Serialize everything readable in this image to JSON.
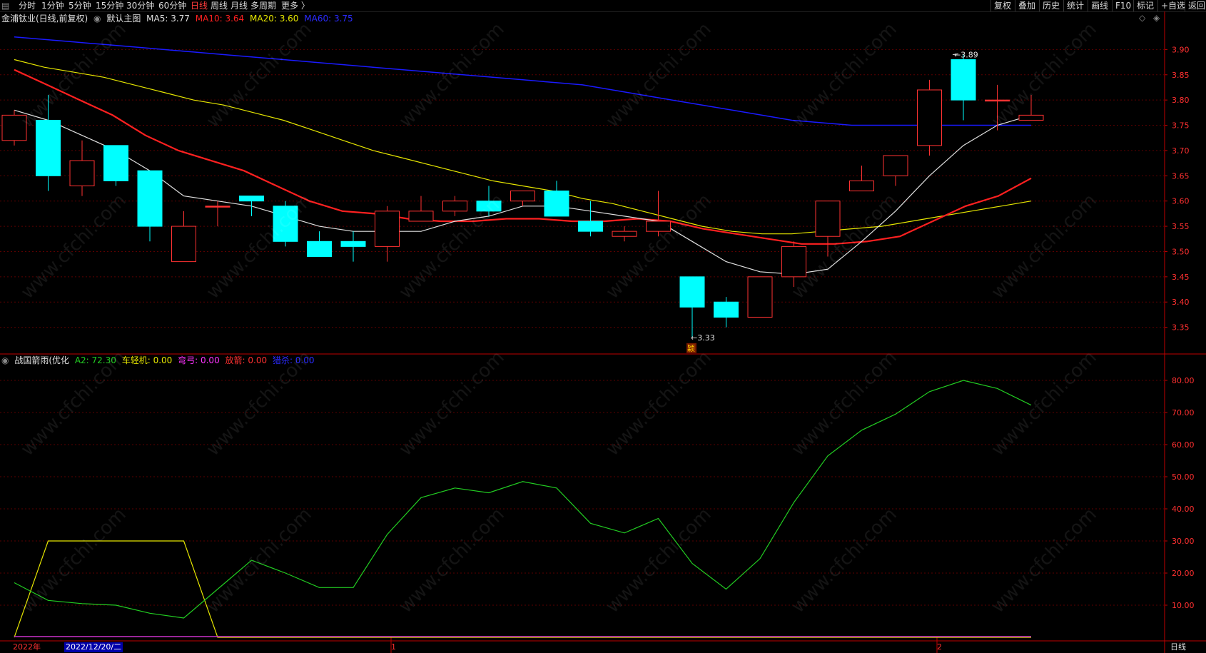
{
  "toolbar": {
    "periods": [
      "分时",
      "1分钟",
      "5分钟",
      "15分钟",
      "30分钟",
      "60分钟",
      "日线",
      "周线",
      "月线",
      "多周期",
      "更多 〉"
    ],
    "active_period": "日线",
    "right_buttons": [
      "复权",
      "叠加",
      "历史",
      "统计",
      "画线",
      "F10",
      "标记",
      "+自选",
      "返回"
    ]
  },
  "main_legend": {
    "stock": "金浦钛业(日线,前复权)",
    "indicator": "默认主图",
    "ma5": "MA5: 3.77",
    "ma10": "MA10: 3.64",
    "ma20": "MA20: 3.60",
    "ma60": "MA60: 3.75"
  },
  "sub_legend": {
    "name": "战国箭雨(优化",
    "a2": "A2: 72.30",
    "chelunji": "车轻机: 0.00",
    "wanggong": "弯弓: 0.00",
    "fangjian": "放箭: 0.00",
    "jiansha": "猎杀: 0.00"
  },
  "bottom": {
    "year": "2022年",
    "date": "2022/12/20/二",
    "m1": "1",
    "m2": "2",
    "period": "日线"
  },
  "annotations": {
    "high": "3.89",
    "low": "3.33",
    "marker": "颖"
  },
  "colors": {
    "up": "#ff3232",
    "down": "#00ffff",
    "ma5": "#e0e0e0",
    "ma10": "#ff2020",
    "ma20": "#e6e600",
    "ma60": "#1a1aff",
    "a2": "#22cc22",
    "yellow_line": "#e6e600",
    "grid": "#5a0000",
    "axis": "#c00000"
  },
  "chart_data": [
    {
      "type": "candlestick",
      "title": "金浦钛业(日线,前复权)",
      "ylim": [
        3.3,
        3.95
      ],
      "yticks": [
        3.35,
        3.4,
        3.45,
        3.5,
        3.55,
        3.6,
        3.65,
        3.7,
        3.75,
        3.8,
        3.85,
        3.9
      ],
      "candles": [
        {
          "o": 3.72,
          "c": 3.77,
          "h": 3.78,
          "l": 3.71
        },
        {
          "o": 3.76,
          "c": 3.65,
          "h": 3.81,
          "l": 3.62
        },
        {
          "o": 3.63,
          "c": 3.68,
          "h": 3.72,
          "l": 3.61
        },
        {
          "o": 3.71,
          "c": 3.64,
          "h": 3.71,
          "l": 3.63
        },
        {
          "o": 3.66,
          "c": 3.55,
          "h": 3.66,
          "l": 3.52
        },
        {
          "o": 3.48,
          "c": 3.55,
          "h": 3.58,
          "l": 3.48
        },
        {
          "o": 3.59,
          "c": 3.59,
          "h": 3.6,
          "l": 3.55
        },
        {
          "o": 3.61,
          "c": 3.6,
          "h": 3.61,
          "l": 3.57
        },
        {
          "o": 3.59,
          "c": 3.52,
          "h": 3.6,
          "l": 3.51
        },
        {
          "o": 3.52,
          "c": 3.49,
          "h": 3.54,
          "l": 3.49
        },
        {
          "o": 3.52,
          "c": 3.51,
          "h": 3.54,
          "l": 3.48
        },
        {
          "o": 3.51,
          "c": 3.58,
          "h": 3.59,
          "l": 3.48
        },
        {
          "o": 3.56,
          "c": 3.58,
          "h": 3.61,
          "l": 3.56
        },
        {
          "o": 3.58,
          "c": 3.6,
          "h": 3.61,
          "l": 3.57
        },
        {
          "o": 3.6,
          "c": 3.58,
          "h": 3.63,
          "l": 3.57
        },
        {
          "o": 3.6,
          "c": 3.62,
          "h": 3.62,
          "l": 3.59
        },
        {
          "o": 3.62,
          "c": 3.57,
          "h": 3.64,
          "l": 3.57
        },
        {
          "o": 3.56,
          "c": 3.54,
          "h": 3.6,
          "l": 3.53
        },
        {
          "o": 3.53,
          "c": 3.54,
          "h": 3.55,
          "l": 3.52
        },
        {
          "o": 3.54,
          "c": 3.56,
          "h": 3.62,
          "l": 3.53
        },
        {
          "o": 3.45,
          "c": 3.39,
          "h": 3.45,
          "l": 3.33
        },
        {
          "o": 3.4,
          "c": 3.37,
          "h": 3.41,
          "l": 3.35
        },
        {
          "o": 3.37,
          "c": 3.45,
          "h": 3.45,
          "l": 3.37
        },
        {
          "o": 3.45,
          "c": 3.51,
          "h": 3.52,
          "l": 3.43
        },
        {
          "o": 3.53,
          "c": 3.6,
          "h": 3.6,
          "l": 3.49
        },
        {
          "o": 3.62,
          "c": 3.64,
          "h": 3.67,
          "l": 3.62
        },
        {
          "o": 3.65,
          "c": 3.69,
          "h": 3.69,
          "l": 3.63
        },
        {
          "o": 3.71,
          "c": 3.82,
          "h": 3.84,
          "l": 3.69
        },
        {
          "o": 3.88,
          "c": 3.8,
          "h": 3.89,
          "l": 3.76
        },
        {
          "o": 3.8,
          "c": 3.8,
          "h": 3.83,
          "l": 3.74
        },
        {
          "o": 3.76,
          "c": 3.77,
          "h": 3.81,
          "l": 3.76
        }
      ],
      "series": [
        {
          "name": "MA5",
          "values": [
            3.78,
            3.76,
            3.73,
            3.7,
            3.66,
            3.61,
            3.6,
            3.59,
            3.57,
            3.55,
            3.54,
            3.54,
            3.54,
            3.56,
            3.57,
            3.59,
            3.59,
            3.58,
            3.57,
            3.56,
            3.52,
            3.48,
            3.46,
            3.455,
            3.465,
            3.52,
            3.58,
            3.65,
            3.71,
            3.75,
            3.77
          ]
        },
        {
          "name": "MA10",
          "values": [
            3.86,
            3.83,
            3.8,
            3.77,
            3.73,
            3.7,
            3.68,
            3.66,
            3.63,
            3.6,
            3.58,
            3.575,
            3.565,
            3.56,
            3.56,
            3.565,
            3.565,
            3.56,
            3.56,
            3.565,
            3.56,
            3.545,
            3.535,
            3.525,
            3.515,
            3.515,
            3.52,
            3.53,
            3.56,
            3.59,
            3.61,
            3.645
          ]
        },
        {
          "name": "MA20",
          "values": [
            3.88,
            3.865,
            3.855,
            3.845,
            3.83,
            3.815,
            3.8,
            3.79,
            3.775,
            3.76,
            3.74,
            3.72,
            3.7,
            3.685,
            3.67,
            3.655,
            3.64,
            3.63,
            3.62,
            3.605,
            3.595,
            3.58,
            3.565,
            3.55,
            3.54,
            3.535,
            3.535,
            3.54,
            3.545,
            3.55,
            3.56,
            3.57,
            3.58,
            3.59,
            3.6
          ]
        },
        {
          "name": "MA60",
          "values": [
            3.925,
            3.92,
            3.915,
            3.91,
            3.905,
            3.9,
            3.895,
            3.89,
            3.885,
            3.88,
            3.875,
            3.87,
            3.865,
            3.86,
            3.855,
            3.85,
            3.845,
            3.84,
            3.835,
            3.83,
            3.82,
            3.81,
            3.8,
            3.79,
            3.78,
            3.77,
            3.76,
            3.755,
            3.75,
            3.75,
            3.75,
            3.75,
            3.75,
            3.75,
            3.75
          ]
        }
      ]
    },
    {
      "type": "line",
      "title": "战国箭雨(优化",
      "ylim": [
        0,
        84
      ],
      "yticks": [
        10,
        20,
        30,
        40,
        50,
        60,
        70,
        80
      ],
      "series": [
        {
          "name": "A2",
          "values": [
            17,
            11.5,
            10.5,
            10,
            7.5,
            6,
            15,
            24,
            20,
            15.5,
            15.5,
            32,
            43.5,
            46.5,
            45,
            48.5,
            46.5,
            35.5,
            32.5,
            37,
            23,
            15,
            24.5,
            42,
            56.5,
            64.5,
            69.5,
            76.5,
            80,
            77.5,
            72.3
          ]
        },
        {
          "name": "车轻机",
          "values": [
            0,
            30,
            30,
            30,
            30,
            30,
            0,
            0,
            0,
            0,
            0,
            0,
            0,
            0,
            0,
            0,
            0,
            0,
            0,
            0,
            0,
            0,
            0,
            0,
            0,
            0,
            0,
            0,
            0,
            0,
            0
          ]
        }
      ]
    }
  ]
}
